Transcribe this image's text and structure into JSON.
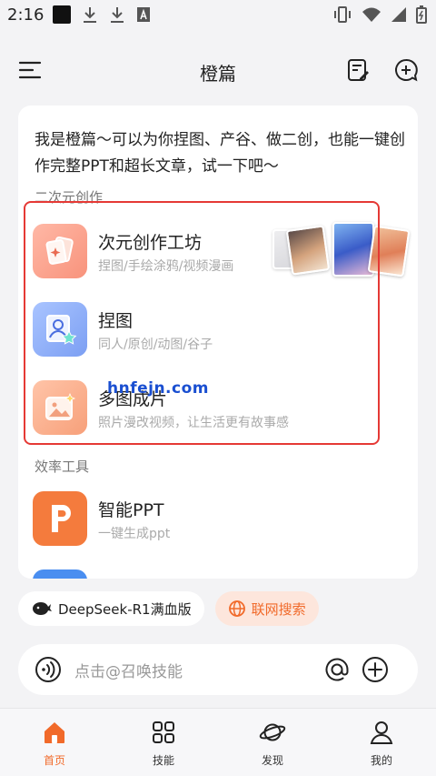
{
  "status_bar": {
    "time": "2:16",
    "left_icons": [
      "app-square-icon",
      "download-icon",
      "download-icon",
      "a-box-icon"
    ],
    "right_icons": [
      "vibrate-icon",
      "wifi-icon",
      "signal-icon",
      "battery-icon"
    ]
  },
  "header": {
    "title": "橙篇",
    "menu_icon": "menu-icon",
    "edit_icon": "edit-note-icon",
    "new_chat_icon": "add-chat-icon"
  },
  "intro_text": "我是橙篇～可以为你捏图、产谷、做二创，也能一键创作完整PPT和超长文章，试一下吧～",
  "sections": [
    {
      "label": "二次元创作",
      "tools": [
        {
          "name": "次元创作工坊",
          "desc": "捏图/手绘涂鸦/视频漫画",
          "icon": "cards-sparkle-icon"
        },
        {
          "name": "捏图",
          "desc": "同人/原创/动图/谷子",
          "icon": "portrait-star-icon"
        },
        {
          "name": "多图成片",
          "desc": "照片漫改视频，让生活更有故事感",
          "icon": "image-sparkle-icon"
        }
      ]
    },
    {
      "label": "效率工具",
      "tools": [
        {
          "name": "智能PPT",
          "desc": "一键生成ppt",
          "icon": "ppt-p-icon"
        }
      ]
    }
  ],
  "watermark": "hnfejn.com",
  "chips": {
    "model": "DeepSeek-R1满血版",
    "search": "联网搜索"
  },
  "input": {
    "placeholder": "点击@召唤技能"
  },
  "tabs": [
    {
      "label": "首页",
      "icon": "home-icon",
      "active": true
    },
    {
      "label": "技能",
      "icon": "grid-icon",
      "active": false
    },
    {
      "label": "发现",
      "icon": "planet-icon",
      "active": false
    },
    {
      "label": "我的",
      "icon": "user-icon",
      "active": false
    }
  ],
  "colors": {
    "accent": "#f16a2a",
    "highlight_border": "#e53935",
    "watermark": "#1a4fd1"
  }
}
